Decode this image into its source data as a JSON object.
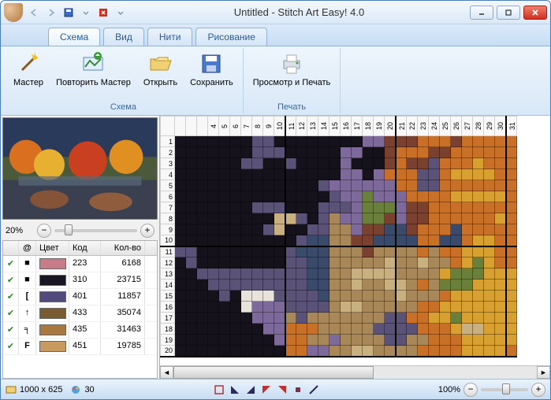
{
  "title": "Untitled - Stitch Art Easy! 4.0",
  "tabs": [
    "Схема",
    "Вид",
    "Нити",
    "Рисование"
  ],
  "active_tab": 0,
  "ribbon": {
    "groups": [
      {
        "label": "Схема",
        "buttons": [
          "Мастер",
          "Повторить Мастер",
          "Открыть",
          "Сохранить"
        ]
      },
      {
        "label": "Печать",
        "buttons": [
          "Просмотр и Печать"
        ]
      }
    ]
  },
  "zoom_left": "20%",
  "color_table": {
    "headers": [
      "",
      "@",
      "Цвет",
      "Код",
      "Кол-во"
    ],
    "rows": [
      {
        "sym": "■",
        "color": "#c77c88",
        "code": "223",
        "qty": "6168"
      },
      {
        "sym": "■",
        "color": "#1a1624",
        "code": "310",
        "qty": "23715"
      },
      {
        "sym": "[",
        "color": "#514a7d",
        "code": "401",
        "qty": "11857"
      },
      {
        "sym": "↑",
        "color": "#7a5a30",
        "code": "433",
        "qty": "35074"
      },
      {
        "sym": "╕",
        "color": "#a87840",
        "code": "435",
        "qty": "31463"
      },
      {
        "sym": "F",
        "color": "#c99a60",
        "code": "451",
        "qty": "19785"
      }
    ]
  },
  "pattern": {
    "cols": 31,
    "rows": 20,
    "col_start": 4,
    "cells": [
      "DDDDDDDSSDDDDDDDDPPBBBOOOBOOOOO",
      "DDDDDDDSSSDDDDDPPDDBOOOBBOOOOOO",
      "DDDDDDSSDDSDDDDPDDDBOBBSOOOYOOO",
      "DDDDDDDDDDDDDDDPPDPOOOSSOYYYYOO",
      "DDDDDDDDDDDDDSPPPPPPOOSSOOOOOOO",
      "DDDDDDDDDDDDDDSPPGPPPOOOOYYYYYO",
      "DDDDDDDSSSDDDSSSPGGGPBBOOOOOOOO",
      "DDDDDDDDDCCSDSTPPGGBPBBOOOOOOYO",
      "DDDDDDDDSCDDSSTTPBBVVBOOOVOOOOO",
      "DDDDDDDDDDDSVVTTBBVVVVOOVVOYYOO",
      "SSDDDDDDDDSVVVTTTBTTTTOTOOYYYOO",
      "DSDDDDDDDDSSVVTTTTTCTTCTTOYGYOO",
      "DDSSSSSSSSSSVVTTCCCCTTTTYGGGYYY",
      "DDDSSSSSSSSSVVTTCTTCCTOTGGGYYYY",
      "DDDDSDWWWSSSSVTTTTTTCTTTOYYYYYY",
      "DDDDDDWPPPSSSSTCCTTTTTOOYYYYYYY",
      "DDDDDDDPPPTSTTTTTTTSSOOYYGYYYYY",
      "DDDDDDDDPPOOOTTTTTSSSSOOOYCCYYY",
      "DDDDDDDDDPOOTTPTTTTSSTTOOOYYYYY",
      "DDDDDDDDDDOOPPTTCCTTTTOOOOYYYYO"
    ],
    "palette": {
      "D": "#16121c",
      "S": "#5a5277",
      "P": "#7e6a9a",
      "B": "#7a4030",
      "O": "#c87028",
      "Y": "#d8a030",
      "G": "#6a803a",
      "T": "#a88858",
      "C": "#c8b080",
      "V": "#3a4a6a",
      "W": "#e8e4dc"
    }
  },
  "status": {
    "dimensions": "1000 x 625",
    "colors": "30",
    "zoom": "100%"
  }
}
